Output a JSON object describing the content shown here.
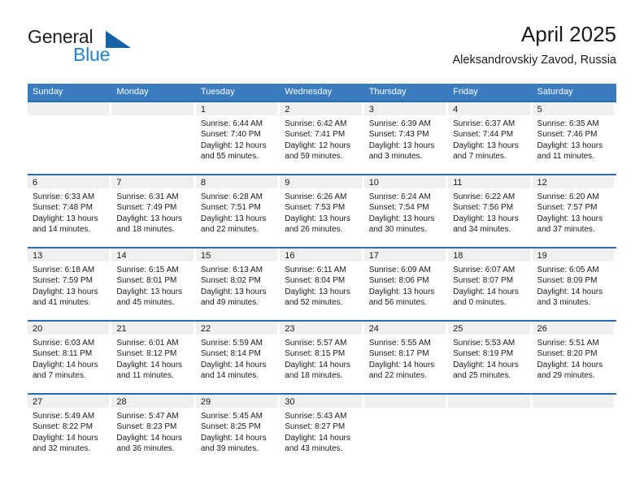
{
  "logo": {
    "word_top": "General",
    "word_bottom": "Blue",
    "flag_icon": "blue-triangle-flag-icon",
    "color_dark": "#231f20",
    "color_blue": "#1f7fd0",
    "color_flag": "#1663a8"
  },
  "header": {
    "title": "April 2025",
    "subtitle": "Aleksandrovskiy Zavod, Russia"
  },
  "theme": {
    "header_blue": "#3a7cbe",
    "row_divider_blue": "#2a6db3",
    "day_band_gray": "#f0f0f0",
    "text": "#1a1a1a"
  },
  "weekdays": [
    "Sunday",
    "Monday",
    "Tuesday",
    "Wednesday",
    "Thursday",
    "Friday",
    "Saturday"
  ],
  "weeks": [
    [
      {
        "day": "",
        "sunrise": "",
        "sunset": "",
        "daylight_1": "",
        "daylight_2": ""
      },
      {
        "day": "",
        "sunrise": "",
        "sunset": "",
        "daylight_1": "",
        "daylight_2": ""
      },
      {
        "day": "1",
        "sunrise": "Sunrise: 6:44 AM",
        "sunset": "Sunset: 7:40 PM",
        "daylight_1": "Daylight: 12 hours",
        "daylight_2": "and 55 minutes."
      },
      {
        "day": "2",
        "sunrise": "Sunrise: 6:42 AM",
        "sunset": "Sunset: 7:41 PM",
        "daylight_1": "Daylight: 12 hours",
        "daylight_2": "and 59 minutes."
      },
      {
        "day": "3",
        "sunrise": "Sunrise: 6:39 AM",
        "sunset": "Sunset: 7:43 PM",
        "daylight_1": "Daylight: 13 hours",
        "daylight_2": "and 3 minutes."
      },
      {
        "day": "4",
        "sunrise": "Sunrise: 6:37 AM",
        "sunset": "Sunset: 7:44 PM",
        "daylight_1": "Daylight: 13 hours",
        "daylight_2": "and 7 minutes."
      },
      {
        "day": "5",
        "sunrise": "Sunrise: 6:35 AM",
        "sunset": "Sunset: 7:46 PM",
        "daylight_1": "Daylight: 13 hours",
        "daylight_2": "and 11 minutes."
      }
    ],
    [
      {
        "day": "6",
        "sunrise": "Sunrise: 6:33 AM",
        "sunset": "Sunset: 7:48 PM",
        "daylight_1": "Daylight: 13 hours",
        "daylight_2": "and 14 minutes."
      },
      {
        "day": "7",
        "sunrise": "Sunrise: 6:31 AM",
        "sunset": "Sunset: 7:49 PM",
        "daylight_1": "Daylight: 13 hours",
        "daylight_2": "and 18 minutes."
      },
      {
        "day": "8",
        "sunrise": "Sunrise: 6:28 AM",
        "sunset": "Sunset: 7:51 PM",
        "daylight_1": "Daylight: 13 hours",
        "daylight_2": "and 22 minutes."
      },
      {
        "day": "9",
        "sunrise": "Sunrise: 6:26 AM",
        "sunset": "Sunset: 7:53 PM",
        "daylight_1": "Daylight: 13 hours",
        "daylight_2": "and 26 minutes."
      },
      {
        "day": "10",
        "sunrise": "Sunrise: 6:24 AM",
        "sunset": "Sunset: 7:54 PM",
        "daylight_1": "Daylight: 13 hours",
        "daylight_2": "and 30 minutes."
      },
      {
        "day": "11",
        "sunrise": "Sunrise: 6:22 AM",
        "sunset": "Sunset: 7:56 PM",
        "daylight_1": "Daylight: 13 hours",
        "daylight_2": "and 34 minutes."
      },
      {
        "day": "12",
        "sunrise": "Sunrise: 6:20 AM",
        "sunset": "Sunset: 7:57 PM",
        "daylight_1": "Daylight: 13 hours",
        "daylight_2": "and 37 minutes."
      }
    ],
    [
      {
        "day": "13",
        "sunrise": "Sunrise: 6:18 AM",
        "sunset": "Sunset: 7:59 PM",
        "daylight_1": "Daylight: 13 hours",
        "daylight_2": "and 41 minutes."
      },
      {
        "day": "14",
        "sunrise": "Sunrise: 6:15 AM",
        "sunset": "Sunset: 8:01 PM",
        "daylight_1": "Daylight: 13 hours",
        "daylight_2": "and 45 minutes."
      },
      {
        "day": "15",
        "sunrise": "Sunrise: 6:13 AM",
        "sunset": "Sunset: 8:02 PM",
        "daylight_1": "Daylight: 13 hours",
        "daylight_2": "and 49 minutes."
      },
      {
        "day": "16",
        "sunrise": "Sunrise: 6:11 AM",
        "sunset": "Sunset: 8:04 PM",
        "daylight_1": "Daylight: 13 hours",
        "daylight_2": "and 52 minutes."
      },
      {
        "day": "17",
        "sunrise": "Sunrise: 6:09 AM",
        "sunset": "Sunset: 8:06 PM",
        "daylight_1": "Daylight: 13 hours",
        "daylight_2": "and 56 minutes."
      },
      {
        "day": "18",
        "sunrise": "Sunrise: 6:07 AM",
        "sunset": "Sunset: 8:07 PM",
        "daylight_1": "Daylight: 14 hours",
        "daylight_2": "and 0 minutes."
      },
      {
        "day": "19",
        "sunrise": "Sunrise: 6:05 AM",
        "sunset": "Sunset: 8:09 PM",
        "daylight_1": "Daylight: 14 hours",
        "daylight_2": "and 3 minutes."
      }
    ],
    [
      {
        "day": "20",
        "sunrise": "Sunrise: 6:03 AM",
        "sunset": "Sunset: 8:11 PM",
        "daylight_1": "Daylight: 14 hours",
        "daylight_2": "and 7 minutes."
      },
      {
        "day": "21",
        "sunrise": "Sunrise: 6:01 AM",
        "sunset": "Sunset: 8:12 PM",
        "daylight_1": "Daylight: 14 hours",
        "daylight_2": "and 11 minutes."
      },
      {
        "day": "22",
        "sunrise": "Sunrise: 5:59 AM",
        "sunset": "Sunset: 8:14 PM",
        "daylight_1": "Daylight: 14 hours",
        "daylight_2": "and 14 minutes."
      },
      {
        "day": "23",
        "sunrise": "Sunrise: 5:57 AM",
        "sunset": "Sunset: 8:15 PM",
        "daylight_1": "Daylight: 14 hours",
        "daylight_2": "and 18 minutes."
      },
      {
        "day": "24",
        "sunrise": "Sunrise: 5:55 AM",
        "sunset": "Sunset: 8:17 PM",
        "daylight_1": "Daylight: 14 hours",
        "daylight_2": "and 22 minutes."
      },
      {
        "day": "25",
        "sunrise": "Sunrise: 5:53 AM",
        "sunset": "Sunset: 8:19 PM",
        "daylight_1": "Daylight: 14 hours",
        "daylight_2": "and 25 minutes."
      },
      {
        "day": "26",
        "sunrise": "Sunrise: 5:51 AM",
        "sunset": "Sunset: 8:20 PM",
        "daylight_1": "Daylight: 14 hours",
        "daylight_2": "and 29 minutes."
      }
    ],
    [
      {
        "day": "27",
        "sunrise": "Sunrise: 5:49 AM",
        "sunset": "Sunset: 8:22 PM",
        "daylight_1": "Daylight: 14 hours",
        "daylight_2": "and 32 minutes."
      },
      {
        "day": "28",
        "sunrise": "Sunrise: 5:47 AM",
        "sunset": "Sunset: 8:23 PM",
        "daylight_1": "Daylight: 14 hours",
        "daylight_2": "and 36 minutes."
      },
      {
        "day": "29",
        "sunrise": "Sunrise: 5:45 AM",
        "sunset": "Sunset: 8:25 PM",
        "daylight_1": "Daylight: 14 hours",
        "daylight_2": "and 39 minutes."
      },
      {
        "day": "30",
        "sunrise": "Sunrise: 5:43 AM",
        "sunset": "Sunset: 8:27 PM",
        "daylight_1": "Daylight: 14 hours",
        "daylight_2": "and 43 minutes."
      },
      {
        "day": "",
        "sunrise": "",
        "sunset": "",
        "daylight_1": "",
        "daylight_2": ""
      },
      {
        "day": "",
        "sunrise": "",
        "sunset": "",
        "daylight_1": "",
        "daylight_2": ""
      },
      {
        "day": "",
        "sunrise": "",
        "sunset": "",
        "daylight_1": "",
        "daylight_2": ""
      }
    ]
  ]
}
